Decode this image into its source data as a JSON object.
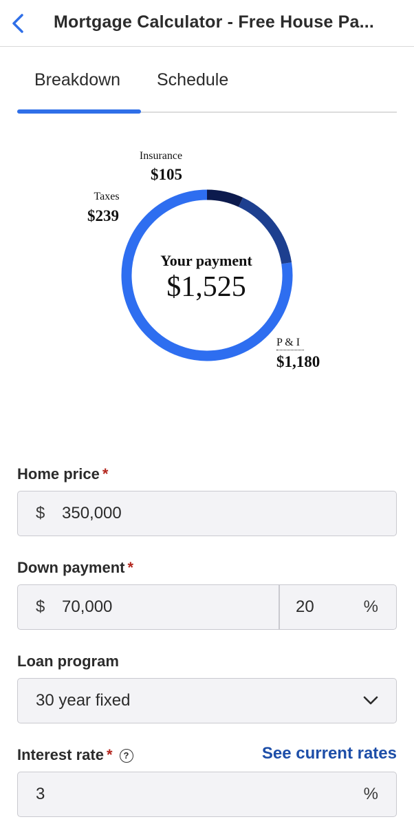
{
  "header": {
    "title": "Mortgage Calculator - Free House Pa..."
  },
  "tabs": [
    {
      "label": "Breakdown",
      "active": true
    },
    {
      "label": "Schedule",
      "active": false
    }
  ],
  "chart_data": {
    "type": "pie",
    "center_title": "Your payment",
    "center_value": "$1,525",
    "total": 1525,
    "slices": [
      {
        "label": "P & I",
        "value": 1180,
        "value_label": "$1,180",
        "color": "#2e6ef0"
      },
      {
        "label": "Taxes",
        "value": 239,
        "value_label": "$239",
        "color": "#1d3f8f"
      },
      {
        "label": "Insurance",
        "value": 105,
        "value_label": "$105",
        "color": "#0c1a4d"
      }
    ]
  },
  "form": {
    "home_price": {
      "label": "Home price",
      "required_mark": "*",
      "prefix": "$",
      "value": "350,000"
    },
    "down_payment": {
      "label": "Down payment",
      "required_mark": "*",
      "prefix": "$",
      "value": "70,000",
      "percent": "20",
      "suffix": "%"
    },
    "loan_program": {
      "label": "Loan program",
      "value": "30 year fixed"
    },
    "interest_rate": {
      "label": "Interest rate",
      "required_mark": "*",
      "help": "?",
      "link": "See current rates",
      "value": "3",
      "suffix": "%"
    }
  },
  "colors": {
    "accent": "#2f6fe8",
    "link": "#1d4ea8",
    "required": "#b3261e"
  },
  "icons": {
    "back": "chevron-left-icon",
    "dropdown": "chevron-down-icon",
    "help": "question-circle-icon"
  }
}
